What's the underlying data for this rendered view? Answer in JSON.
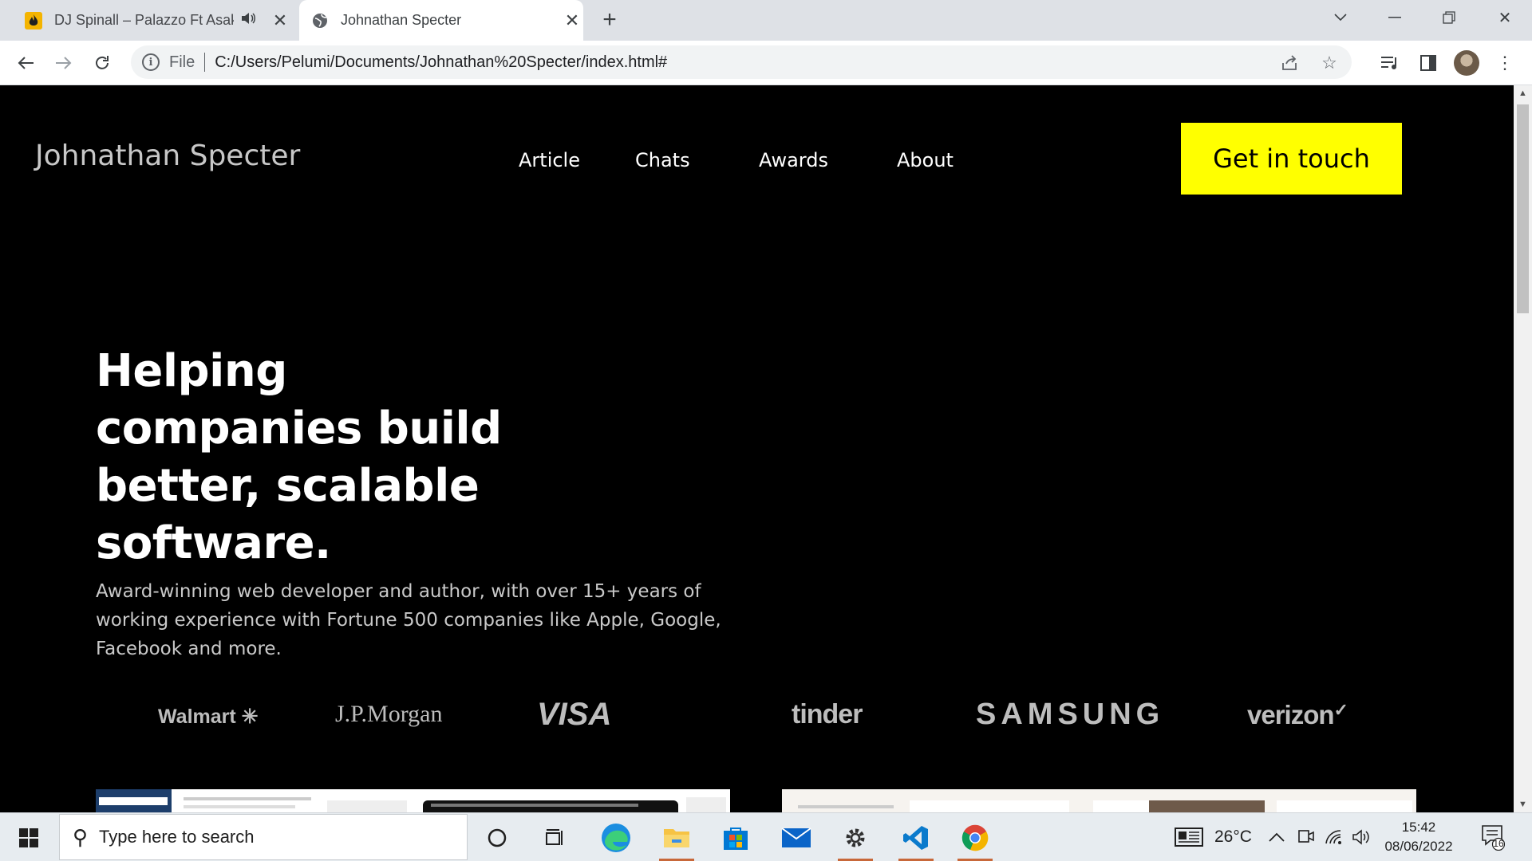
{
  "browser": {
    "tabs": [
      {
        "title": "DJ Spinall – Palazzo Ft Asake",
        "favicon": "flame-icon",
        "audio": true,
        "active": false
      },
      {
        "title": "Johnathan Specter",
        "favicon": "globe-icon",
        "active": true
      }
    ],
    "address": {
      "scheme_label": "File",
      "url": "C:/Users/Pelumi/Documents/Johnathan%20Specter/index.html#"
    }
  },
  "site": {
    "logo": "Johnathan Specter",
    "nav": [
      "Article",
      "Chats",
      "Awards",
      "About"
    ],
    "cta": "Get in touch",
    "accent_color": "#ffff00",
    "hero": {
      "title": "Helping companies build better, scalable software.",
      "subtitle": "Award-winning web developer and author, with over 15+ years of working experience with Fortune 500 companies like Apple, Google, Facebook and more."
    },
    "brands": [
      "Walmart",
      "J.P.Morgan",
      "VISA",
      "tinder",
      "SAMSUNG",
      "verizon"
    ]
  },
  "taskbar": {
    "search_placeholder": "Type here to search",
    "weather": "26°C",
    "time": "15:42",
    "date": "08/06/2022",
    "notifications": "16"
  }
}
